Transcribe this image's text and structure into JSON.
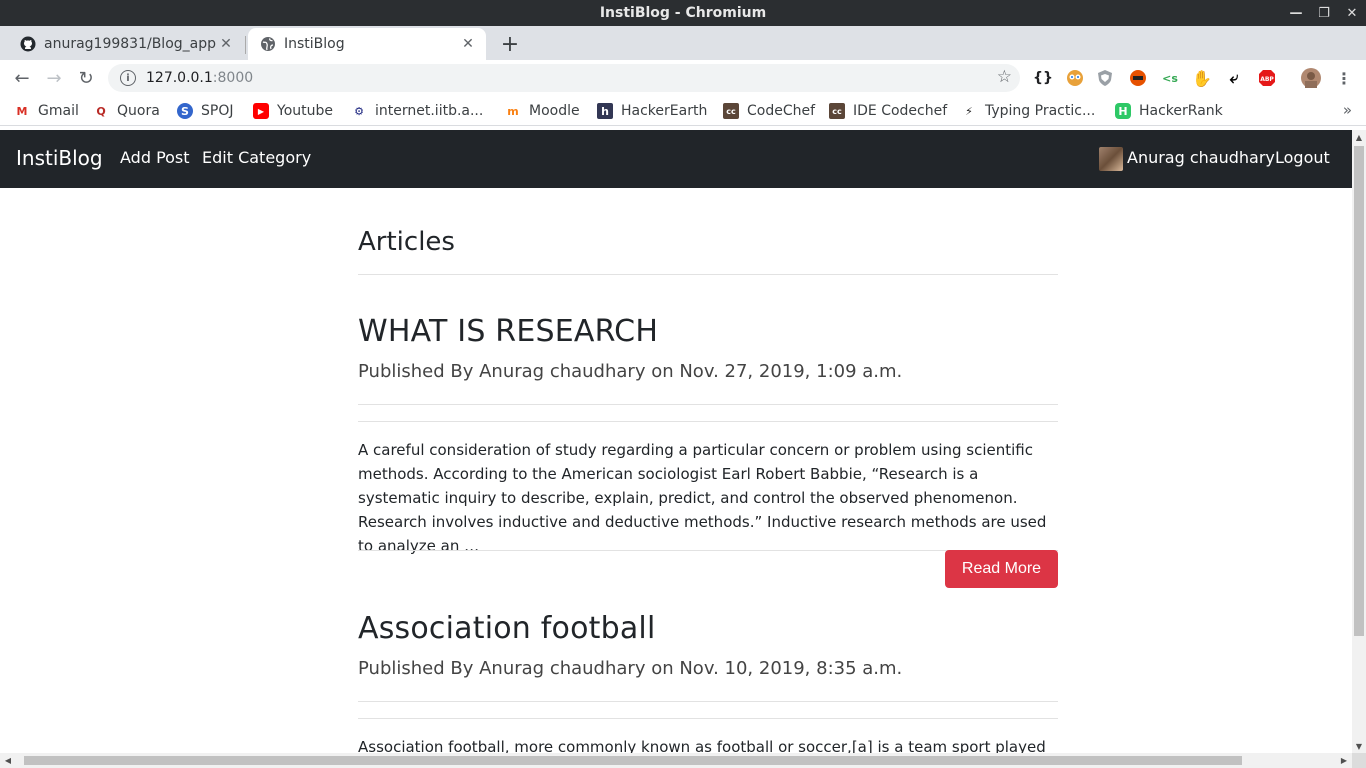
{
  "window": {
    "title": "InstiBlog - Chromium"
  },
  "tabs": [
    {
      "title": "anurag199831/Blog_app"
    },
    {
      "title": "InstiBlog"
    }
  ],
  "toolbar": {
    "url_host": "127.0.0.1",
    "url_port": ":8000"
  },
  "bookmarks": [
    {
      "label": "Gmail",
      "icon": "gmail-icon",
      "color": "#d93025"
    },
    {
      "label": "Quora",
      "icon": "quora-icon",
      "color": "#b92b27"
    },
    {
      "label": "SPOJ",
      "icon": "spoj-icon",
      "color": "#3366cc"
    },
    {
      "label": "Youtube",
      "icon": "youtube-icon",
      "color": "#ff0000"
    },
    {
      "label": "internet.iitb.a...",
      "icon": "iitb-icon",
      "color": "#1a237e"
    },
    {
      "label": "Moodle",
      "icon": "moodle-icon",
      "color": "#f98012"
    },
    {
      "label": "HackerEarth",
      "icon": "hackerearth-icon",
      "color": "#323754"
    },
    {
      "label": "CodeChef",
      "icon": "codechef-icon",
      "color": "#5b4638"
    },
    {
      "label": "IDE Codechef",
      "icon": "codechef-icon",
      "color": "#5b4638"
    },
    {
      "label": "Typing Practic...",
      "icon": "bolt-icon",
      "color": "#222222"
    },
    {
      "label": "HackerRank",
      "icon": "hackerrank-icon",
      "color": "#2ec866"
    }
  ],
  "navbar": {
    "brand": "InstiBlog",
    "links": [
      "Add Post",
      "Edit Category"
    ],
    "user": "Anurag chaudhary",
    "logout": "Logout"
  },
  "page": {
    "heading": "Articles",
    "posts": [
      {
        "title": "WHAT IS RESEARCH",
        "meta": "Published By Anurag chaudhary on Nov. 27, 2019, 1:09 a.m.",
        "excerpt": "A careful consideration of study regarding a particular concern or problem using scientific methods. According to the American sociologist Earl Robert Babbie, “Research is a systematic inquiry to describe, explain, predict, and control the observed phenomenon. Research involves inductive and deductive methods.” Inductive research methods are used to analyze an …",
        "button": "Read More"
      },
      {
        "title": "Association football",
        "meta": "Published By Anurag chaudhary on Nov. 10, 2019, 8:35 a.m.",
        "excerpt": "Association football, more commonly known as football or soccer,[a] is a team sport played with"
      }
    ]
  },
  "colors": {
    "navbar": "#212529",
    "read_more": "#dc3545"
  }
}
